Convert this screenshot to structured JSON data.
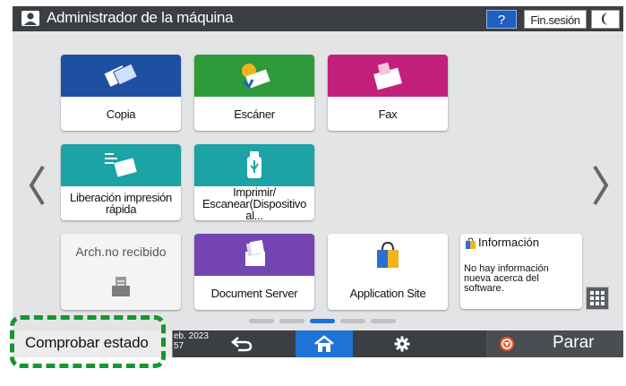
{
  "header": {
    "title": "Administrador de la máquina",
    "help_label": "?",
    "logout_label": "Fin.sesión"
  },
  "apps": [
    {
      "label": "Copia",
      "color": "#1f4fa0"
    },
    {
      "label": "Escáner",
      "color": "#2f9a3a"
    },
    {
      "label": "Fax",
      "color": "#c2207a"
    },
    {
      "label_line1": "Liberación impresión",
      "label_line2": "rápida",
      "color": "#1ca3a6"
    },
    {
      "label_line1": "Imprimir/",
      "label_line2": "Escanear(Dispositivo al...",
      "color": "#1ca3a6"
    },
    {
      "label": "Arch.no recibido",
      "disabled": true
    },
    {
      "label": "Document Server",
      "color": "#7445b0"
    },
    {
      "label": "Application Site"
    }
  ],
  "info_widget": {
    "title": "Información",
    "text_line1": "No hay información",
    "text_line2": "nueva acerca del",
    "text_line3": "software."
  },
  "pager": {
    "pages": 5,
    "current_page": 3
  },
  "bottom": {
    "status_label": "Comprobar estado",
    "date_line1": "eb. 2023",
    "date_line2": "57",
    "stop_label": "Parar"
  },
  "colors": {
    "home_active": "#1e73d6",
    "highlight": "#17962f"
  }
}
